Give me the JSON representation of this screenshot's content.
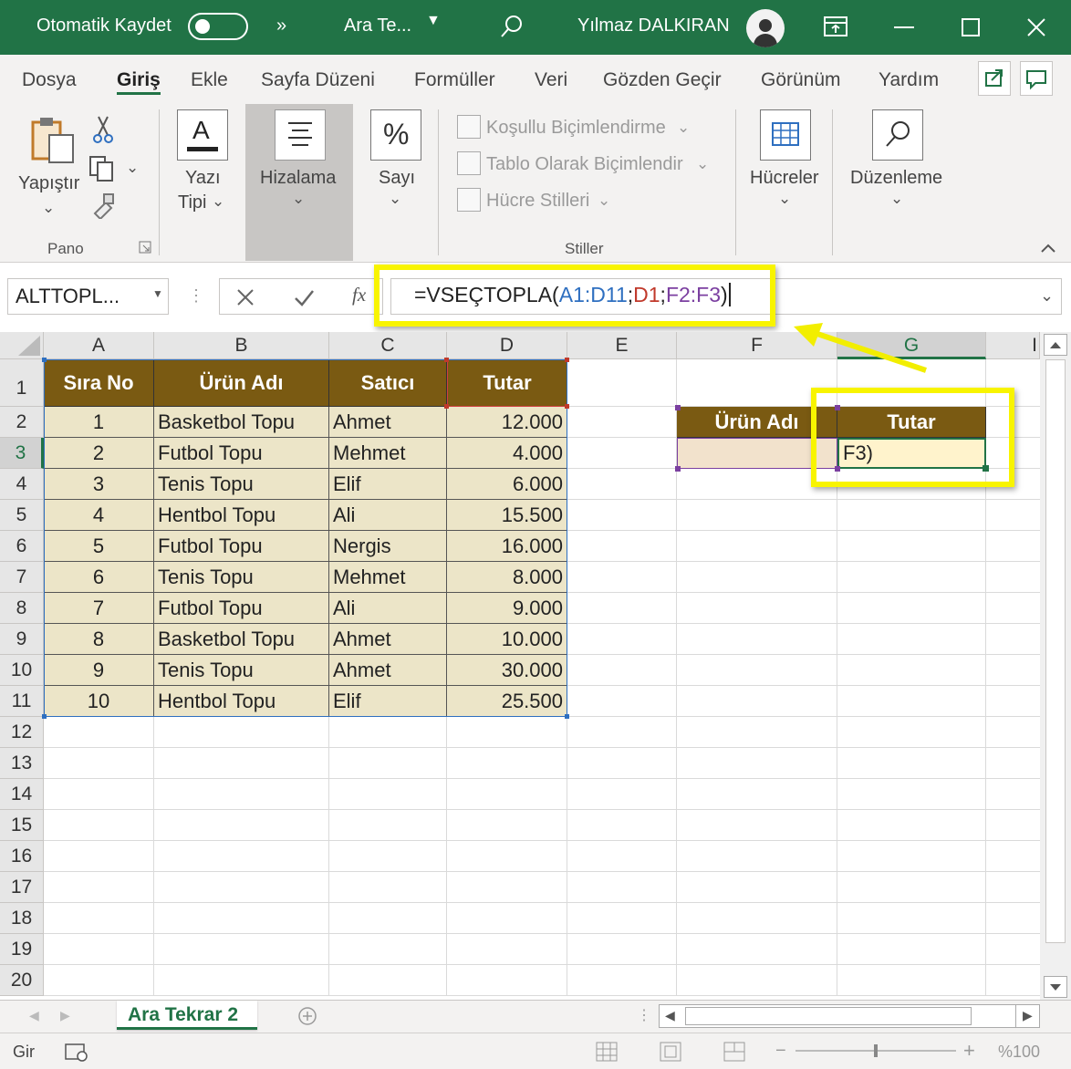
{
  "titlebar": {
    "autosave_label": "Otomatik Kaydet",
    "more": "»",
    "doc_name": "Ara Te...",
    "user": "Yılmaz DALKIRAN",
    "colors": {
      "bar": "#217346"
    }
  },
  "menu": {
    "tabs": [
      "Dosya",
      "Giriş",
      "Ekle",
      "Sayfa Düzeni",
      "Formüller",
      "Veri",
      "Gözden Geçir",
      "Görünüm",
      "Yardım"
    ],
    "active": "Giriş"
  },
  "ribbon": {
    "paste": "Yapıştır",
    "pano": "Pano",
    "font_1": "Yazı",
    "font_2": "Tipi",
    "alignment": "Hizalama",
    "number": "Sayı",
    "conditional": "Koşullu Biçimlendirme",
    "as_table": "Tablo Olarak Biçimlendir",
    "cell_styles": "Hücre Stilleri",
    "styles": "Stiller",
    "cells": "Hücreler",
    "editing": "Düzenleme"
  },
  "formula_bar": {
    "name_box": "ALTTOPL...",
    "fx": "fx",
    "f_eq": "=VSEÇTOPLA(",
    "f_r1": "A1:D11",
    "f_s1": ";",
    "f_r2": "D1",
    "f_s2": ";",
    "f_r3": "F2:F3",
    "f_end": ")",
    "colors": {
      "r1": "#2e6fc0",
      "r2": "#c0392b",
      "r3": "#7b3fa0"
    }
  },
  "columns": [
    "A",
    "B",
    "C",
    "D",
    "E",
    "F",
    "G",
    "I"
  ],
  "rows": [
    "1",
    "2",
    "3",
    "4",
    "5",
    "6",
    "7",
    "8",
    "9",
    "10",
    "11",
    "12",
    "13",
    "14",
    "15",
    "16",
    "17",
    "18",
    "19",
    "20"
  ],
  "table": {
    "headers": [
      "Sıra No",
      "Ürün Adı",
      "Satıcı",
      "Tutar"
    ],
    "rows": [
      [
        "1",
        "Basketbol Topu",
        "Ahmet",
        "12.000"
      ],
      [
        "2",
        "Futbol Topu",
        "Mehmet",
        "4.000"
      ],
      [
        "3",
        "Tenis Topu",
        "Elif",
        "6.000"
      ],
      [
        "4",
        "Hentbol Topu",
        "Ali",
        "15.500"
      ],
      [
        "5",
        "Futbol Topu",
        "Nergis",
        "16.000"
      ],
      [
        "6",
        "Tenis Topu",
        "Mehmet",
        "8.000"
      ],
      [
        "7",
        "Futbol Topu",
        "Ali",
        "9.000"
      ],
      [
        "8",
        "Basketbol Topu",
        "Ahmet",
        "10.000"
      ],
      [
        "9",
        "Tenis Topu",
        "Ahmet",
        "30.000"
      ],
      [
        "10",
        "Hentbol Topu",
        "Elif",
        "25.500"
      ]
    ],
    "colors": {
      "header_bg": "#7a5a12",
      "data_bg": "#ece5c8"
    }
  },
  "criteria": {
    "h1": "Ürün Adı",
    "h2": "Tutar",
    "g3": "F3)"
  },
  "sheet_tab": "Ara Tekrar 2",
  "status": {
    "mode": "Gir",
    "zoom": "%100"
  }
}
